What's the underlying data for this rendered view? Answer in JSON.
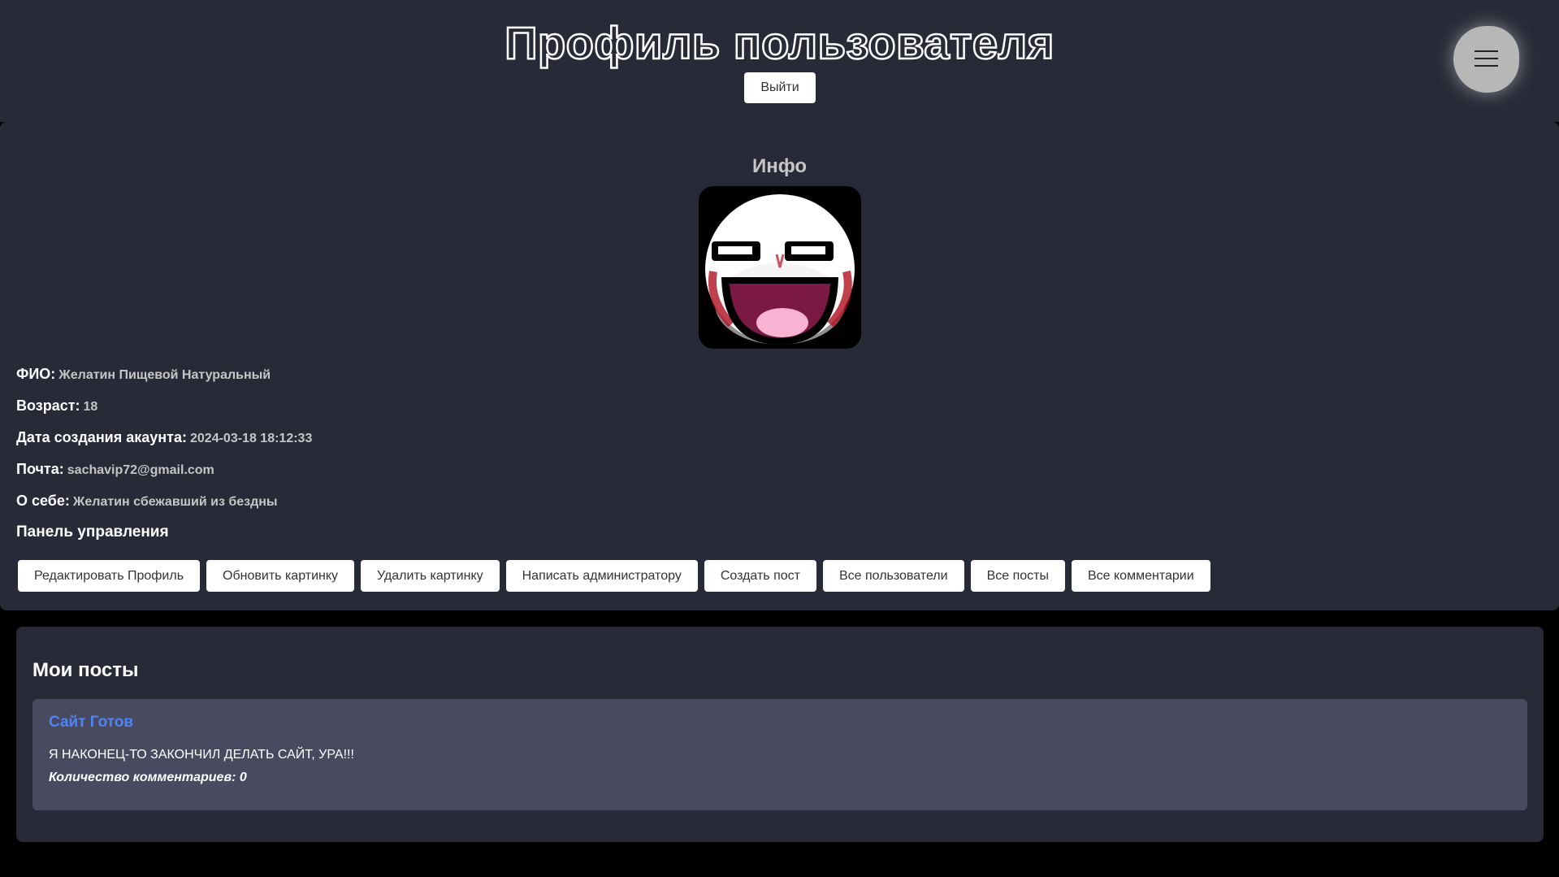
{
  "header": {
    "title": "Профиль пользователя",
    "logout_label": "Выйти",
    "menu_icon": "hamburger-icon"
  },
  "info": {
    "title": "Инфо",
    "avatar": "awesome-face-avatar",
    "fields": [
      {
        "label": "ФИО:",
        "value": "Желатин Пищевой Натуральный"
      },
      {
        "label": "Возраст:",
        "value": "18"
      },
      {
        "label": "Дата создания акаунта:",
        "value": "2024-03-18 18:12:33"
      },
      {
        "label": "Почта:",
        "value": "sachavip72@gmail.com"
      },
      {
        "label": "О себе:",
        "value": "Желатин сбежавший из бездны"
      }
    ]
  },
  "control_panel": {
    "title": "Панель управления",
    "buttons": [
      "Редактировать Профиль",
      "Обновить картинку",
      "Удалить картинку",
      "Написать администратору",
      "Создать пост",
      "Все пользователи",
      "Все посты",
      "Все комментарии"
    ]
  },
  "posts": {
    "title": "Мои посты",
    "items": [
      {
        "title": "Сайт Готов",
        "body": "Я НАКОНЕЦ-ТО ЗАКОНЧИЛ ДЕЛАТЬ САЙТ, УРА!!!",
        "comments": "Количество комментариев: 0"
      }
    ]
  },
  "colors": {
    "background": "#000000",
    "panel": "#282a37",
    "post_card": "#484b60",
    "link": "#4f84f5",
    "muted_text": "#c6c6c6"
  }
}
